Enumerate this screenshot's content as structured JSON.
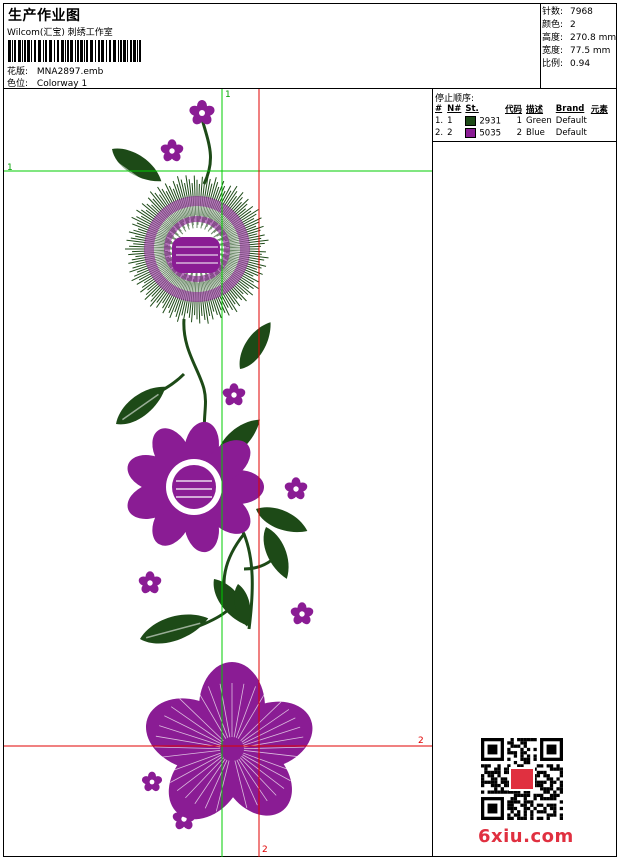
{
  "header": {
    "title": "生产作业图",
    "studio": "Wilcom(汇宝) 刺绣工作室",
    "design_label": "花版:",
    "design_value": "MNA2897.emb",
    "colorway_label": "色位:",
    "colorway_value": "Colorway 1"
  },
  "stats": [
    {
      "label": "针数:",
      "value": "7968"
    },
    {
      "label": "颜色:",
      "value": "2"
    },
    {
      "label": "高度:",
      "value": "270.8 mm"
    },
    {
      "label": "宽度:",
      "value": "77.5 mm"
    },
    {
      "label": "比例:",
      "value": "0.94"
    }
  ],
  "stop_sequence": {
    "title": "停止顺序:",
    "headers": [
      "#",
      "N#",
      "St.",
      "代码",
      "描述",
      "Brand",
      "元素"
    ],
    "rows": [
      {
        "num": "1.",
        "n": "1",
        "st": "2931",
        "code": "1",
        "desc": "Green",
        "brand": "Default",
        "color": "#1d4a17"
      },
      {
        "num": "2.",
        "n": "2",
        "st": "5035",
        "code": "2",
        "desc": "Blue",
        "brand": "Default",
        "color": "#8a1c94"
      }
    ]
  },
  "guides": {
    "green_top": "1",
    "green_left": "1",
    "red_right": "2",
    "red_bottom": "2"
  },
  "colors": {
    "thread_green": "#1d4a17",
    "thread_purple": "#8a1c94",
    "guide_green": "#00cc00",
    "guide_red": "#e00000",
    "logo": "#e03040"
  },
  "watermark": {
    "logo_text": "6xiu.com"
  }
}
